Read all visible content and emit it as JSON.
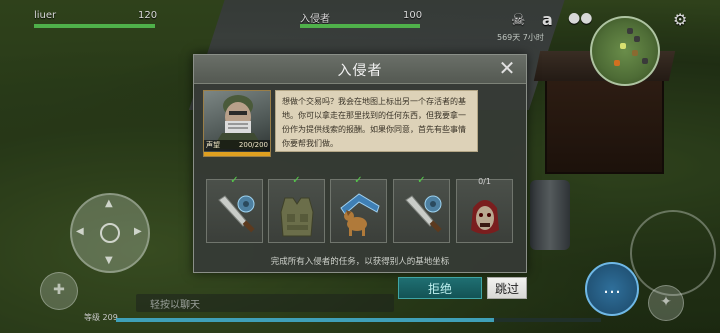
{
  "hud": {
    "player_name": "liuer",
    "player_hp": "120",
    "invader_name": "入侵者",
    "invader_hp": "100",
    "time": "569天 7小时",
    "icons": [
      "skull-icon",
      "amazon-a-icon",
      "group-icon",
      "gear-icon"
    ]
  },
  "dialog": {
    "title": "入侵者",
    "npc_name": "声望",
    "npc_reputation": "200/200",
    "message": "想做个交易吗？我会在地图上标出另一个存活者的基地。你可以拿走在那里找到的任何东西，但我要拿一份作为提供线索的报酬。如果你同意，首先有些事情你要帮我们做。",
    "items": [
      {
        "name": "machete-with-gear",
        "status": "complete"
      },
      {
        "name": "military-vest",
        "status": "complete"
      },
      {
        "name": "dog-with-shelter",
        "status": "complete"
      },
      {
        "name": "machete-with-gear",
        "status": "complete"
      },
      {
        "name": "zombie-head",
        "status": "progress",
        "count": "0/1"
      }
    ],
    "task_note": "完成所有入侵者的任务，以获得别人的基地坐标",
    "reject_label": "拒绝",
    "skip_label": "跳过"
  },
  "chat": {
    "placeholder": "轻按以聊天"
  },
  "player": {
    "level": "等级 209",
    "xp_fraction": 0.78
  },
  "colors": {
    "health_green": "#4fb04a",
    "check_green": "#56d24a",
    "reject_teal": "#1f6f72",
    "message_paper": "#ddd2b8"
  }
}
